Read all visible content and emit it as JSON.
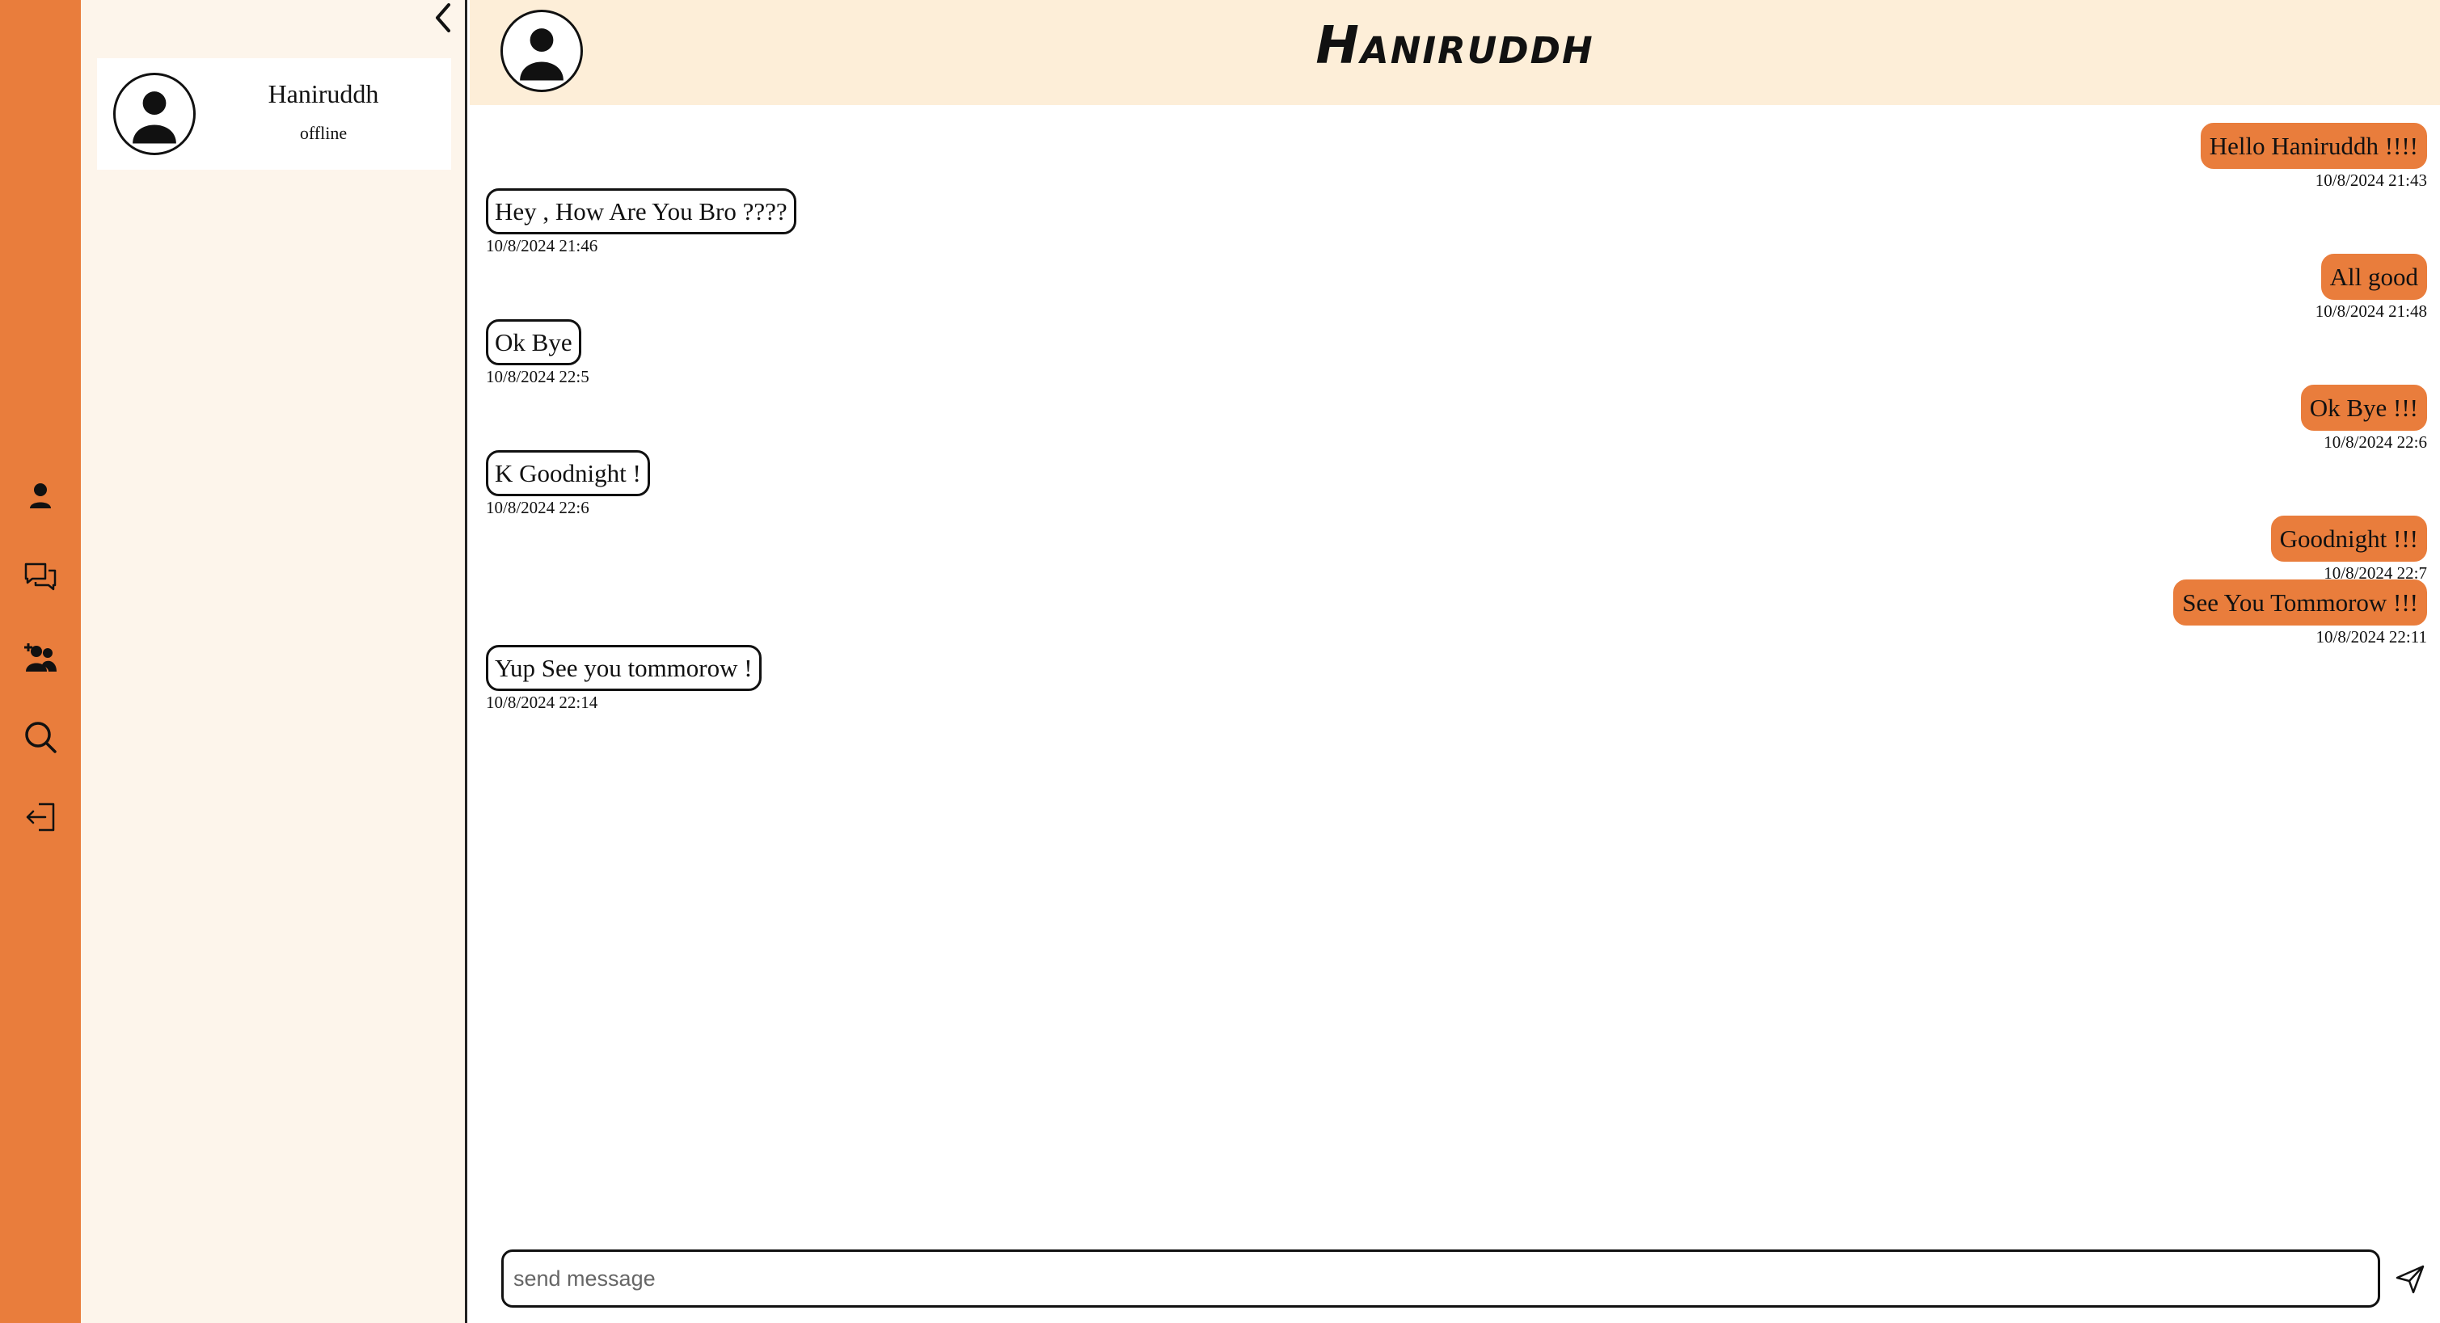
{
  "colors": {
    "accent": "#e97d3c",
    "sidebar_bg": "#fdf5eb",
    "header_bg": "#fdeed8"
  },
  "nav": {
    "icons": [
      "person-icon",
      "chat-icon",
      "add-friend-icon",
      "search-icon",
      "logout-icon"
    ]
  },
  "sidebar": {
    "collapse_icon": "chevron-left-icon",
    "contacts": [
      {
        "name": "Haniruddh",
        "status": "offline"
      }
    ]
  },
  "chat": {
    "title": "Haniruddh",
    "messages": [
      {
        "direction": "out",
        "text": "Hello Haniruddh !!!!",
        "time": "10/8/2024 21:43"
      },
      {
        "direction": "in",
        "text": "Hey , How Are You Bro ????",
        "time": "10/8/2024 21:46"
      },
      {
        "direction": "out",
        "text": "All good",
        "time": "10/8/2024 21:48"
      },
      {
        "direction": "in",
        "text": "Ok Bye",
        "time": "10/8/2024 22:5"
      },
      {
        "direction": "out",
        "text": "Ok Bye !!!",
        "time": "10/8/2024 22:6"
      },
      {
        "direction": "in",
        "text": "K Goodnight !",
        "time": "10/8/2024 22:6"
      },
      {
        "direction": "out",
        "text": "Goodnight !!!",
        "time": "10/8/2024 22:7"
      },
      {
        "direction": "out",
        "text": "See You Tommorow !!!",
        "time": "10/8/2024 22:11"
      },
      {
        "direction": "in",
        "text": "Yup See you tommorow !",
        "time": "10/8/2024 22:14"
      }
    ]
  },
  "composer": {
    "placeholder": "send message",
    "send_icon": "send-icon"
  }
}
